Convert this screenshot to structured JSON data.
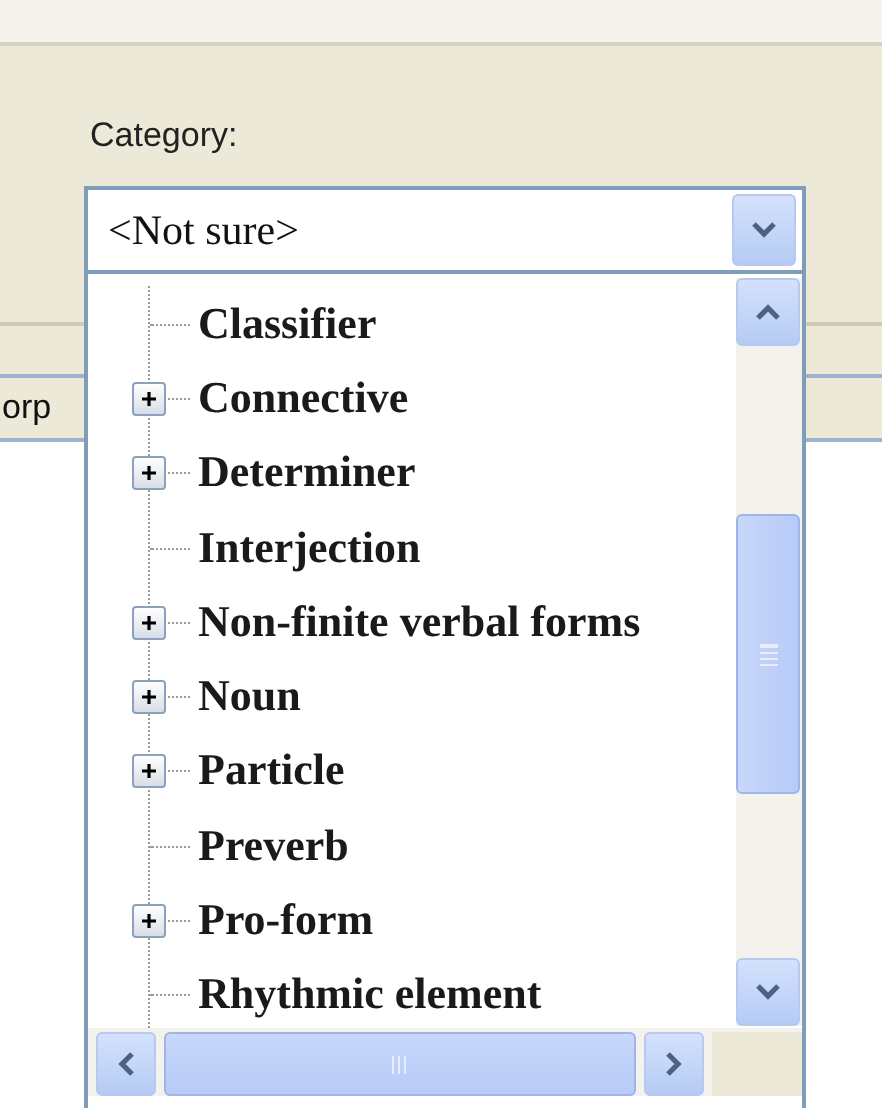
{
  "background_label": "orp",
  "category": {
    "label": "Category:",
    "value": "<Not sure>"
  },
  "tree_items": [
    {
      "label": "Classifier",
      "kind": "leaf"
    },
    {
      "label": "Connective",
      "kind": "branch"
    },
    {
      "label": "Determiner",
      "kind": "branch"
    },
    {
      "label": "Interjection",
      "kind": "leaf"
    },
    {
      "label": "Non-finite verbal forms",
      "kind": "branch"
    },
    {
      "label": "Noun",
      "kind": "branch"
    },
    {
      "label": "Particle",
      "kind": "branch"
    },
    {
      "label": "Preverb",
      "kind": "leaf"
    },
    {
      "label": "Pro-form",
      "kind": "branch"
    },
    {
      "label": "Rhythmic element",
      "kind": "leaf"
    }
  ]
}
